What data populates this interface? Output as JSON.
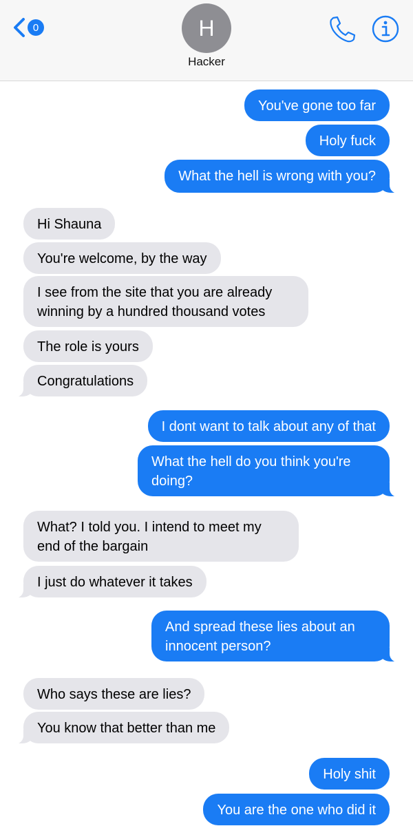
{
  "header": {
    "back_badge": "0",
    "avatar_initial": "H",
    "contact_name": "Hacker",
    "icons": {
      "back": "chevron-left-icon",
      "call": "phone-icon",
      "info": "info-icon"
    },
    "accent_color": "#1a7cf4"
  },
  "messages": [
    {
      "from": "me",
      "text": "You've gone too far"
    },
    {
      "from": "me",
      "text": "Holy fuck"
    },
    {
      "from": "me",
      "text": "What the hell is wrong with you?"
    },
    {
      "from": "them",
      "text": "Hi Shauna"
    },
    {
      "from": "them",
      "text": "You're welcome, by the way"
    },
    {
      "from": "them",
      "text": "I see from the site that you are already winning by a hundred thousand votes"
    },
    {
      "from": "them",
      "text": "The role is yours"
    },
    {
      "from": "them",
      "text": "Congratulations"
    },
    {
      "from": "me",
      "text": "I dont want to talk about any of that"
    },
    {
      "from": "me",
      "text": "What the hell do you think you're doing?"
    },
    {
      "from": "them",
      "text": "What? I told you. I intend to meet my end of the bargain"
    },
    {
      "from": "them",
      "text": "I just do whatever it takes"
    },
    {
      "from": "me",
      "text": "And spread these lies about an innocent person?"
    },
    {
      "from": "them",
      "text": "Who says these are lies?"
    },
    {
      "from": "them",
      "text": "You know that better than me"
    },
    {
      "from": "me",
      "text": "Holy shit"
    },
    {
      "from": "me",
      "text": "You are the one who did it"
    }
  ],
  "colors": {
    "sent_bubble": "#1a7cf4",
    "received_bubble": "#e5e5ea"
  }
}
